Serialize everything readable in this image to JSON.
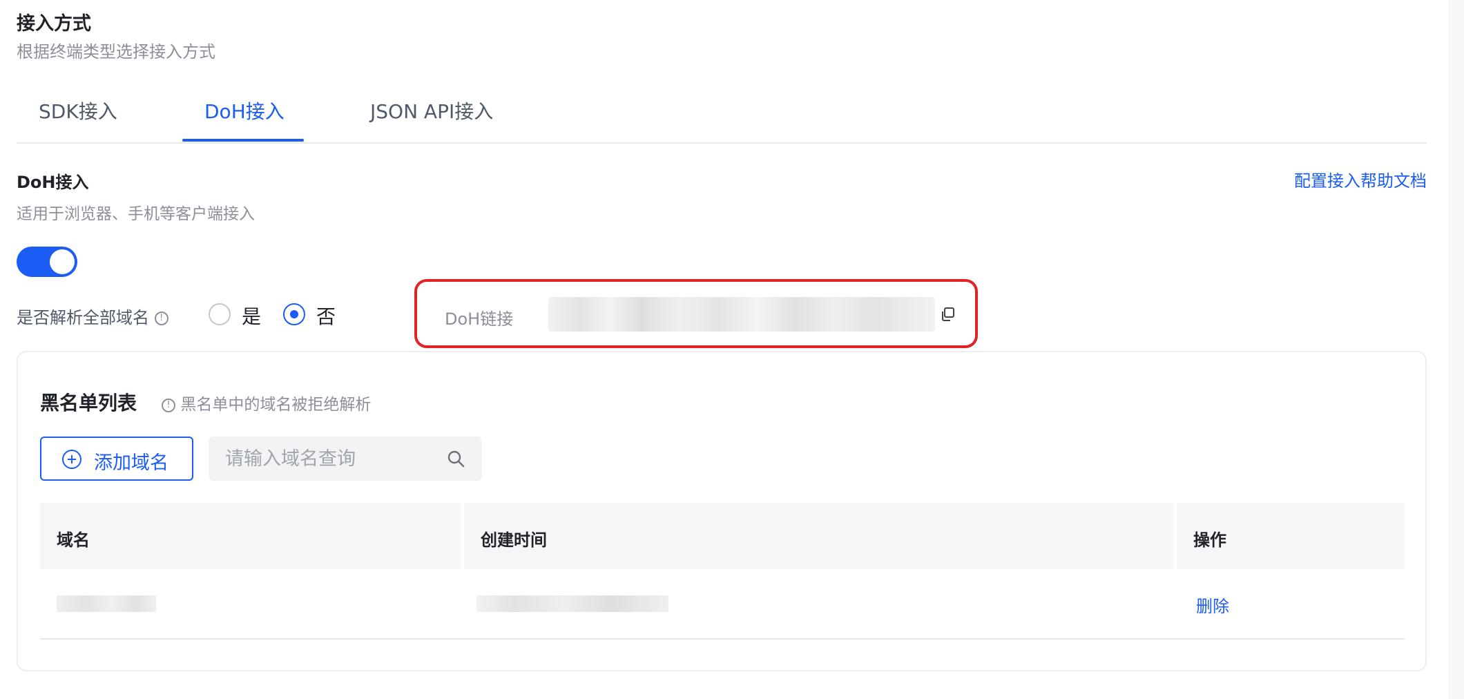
{
  "section": {
    "title": "接入方式",
    "subtitle": "根据终端类型选择接入方式"
  },
  "tabs": [
    {
      "label": "SDK接入",
      "active": false
    },
    {
      "label": "DoH接入",
      "active": true
    },
    {
      "label": "JSON API接入",
      "active": false
    }
  ],
  "doh": {
    "title": "DoH接入",
    "subtitle": "适用于浏览器、手机等客户端接入",
    "help_link": "配置接入帮助文档",
    "enabled": true,
    "resolve_all_label": "是否解析全部域名",
    "resolve_all_options": [
      {
        "label": "是",
        "checked": false
      },
      {
        "label": "否",
        "checked": true
      }
    ],
    "link_label": "DoH链接",
    "link_value": ""
  },
  "blacklist": {
    "title": "黑名单列表",
    "hint": "黑名单中的域名被拒绝解析",
    "add_button": "添加域名",
    "search_placeholder": "请输入域名查询",
    "columns": [
      "域名",
      "创建时间",
      "操作"
    ],
    "rows": [
      {
        "domain": "",
        "created": "",
        "action": "删除"
      }
    ]
  },
  "colors": {
    "accent": "#1b5cf5",
    "highlight_border": "#e02424"
  }
}
